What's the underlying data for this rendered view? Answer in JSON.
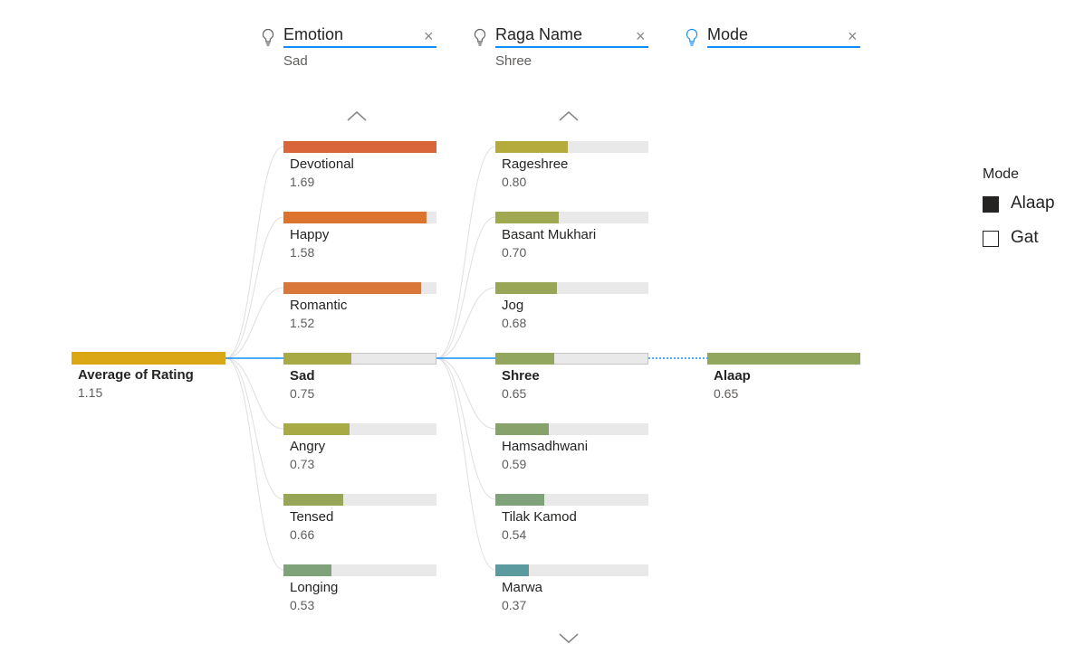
{
  "root": {
    "label": "Average of Rating",
    "value": "1.15",
    "value_num": 1.15,
    "color": "#dba714"
  },
  "levels": [
    {
      "title": "Emotion",
      "selected": "Sad",
      "nodes": [
        {
          "label": "Devotional",
          "value": "1.69",
          "value_num": 1.69,
          "color": "#d9663a"
        },
        {
          "label": "Happy",
          "value": "1.58",
          "value_num": 1.58,
          "color": "#dc7430"
        },
        {
          "label": "Romantic",
          "value": "1.52",
          "value_num": 1.52,
          "color": "#d9773a"
        },
        {
          "label": "Sad",
          "value": "0.75",
          "value_num": 0.75,
          "color": "#a7aa45",
          "selected": true
        },
        {
          "label": "Angry",
          "value": "0.73",
          "value_num": 0.73,
          "color": "#a7aa45"
        },
        {
          "label": "Tensed",
          "value": "0.66",
          "value_num": 0.66,
          "color": "#97a556"
        },
        {
          "label": "Longing",
          "value": "0.53",
          "value_num": 0.53,
          "color": "#7fa27a"
        }
      ]
    },
    {
      "title": "Raga Name",
      "selected": "Shree",
      "nodes": [
        {
          "label": "Rageshree",
          "value": "0.80",
          "value_num": 0.8,
          "color": "#b4ab3c"
        },
        {
          "label": "Basant Mukhari",
          "value": "0.70",
          "value_num": 0.7,
          "color": "#a1a852"
        },
        {
          "label": "Jog",
          "value": "0.68",
          "value_num": 0.68,
          "color": "#99a658"
        },
        {
          "label": "Shree",
          "value": "0.65",
          "value_num": 0.65,
          "color": "#93a65e",
          "selected": true
        },
        {
          "label": "Hamsadhwani",
          "value": "0.59",
          "value_num": 0.59,
          "color": "#87a26a"
        },
        {
          "label": "Tilak Kamod",
          "value": "0.54",
          "value_num": 0.54,
          "color": "#7fa27a"
        },
        {
          "label": "Marwa",
          "value": "0.37",
          "value_num": 0.37,
          "color": "#5b9a9f"
        }
      ]
    },
    {
      "title": "Mode",
      "nodes": [
        {
          "label": "Alaap",
          "value": "0.65",
          "value_num": 0.65,
          "color": "#93a65e",
          "selected": true
        }
      ]
    }
  ],
  "legend": {
    "title": "Mode",
    "items": [
      {
        "label": "Alaap",
        "filled": true
      },
      {
        "label": "Gat",
        "filled": false
      }
    ]
  },
  "colors": {
    "accent": "#118dff",
    "track": "#e9e9e9"
  }
}
